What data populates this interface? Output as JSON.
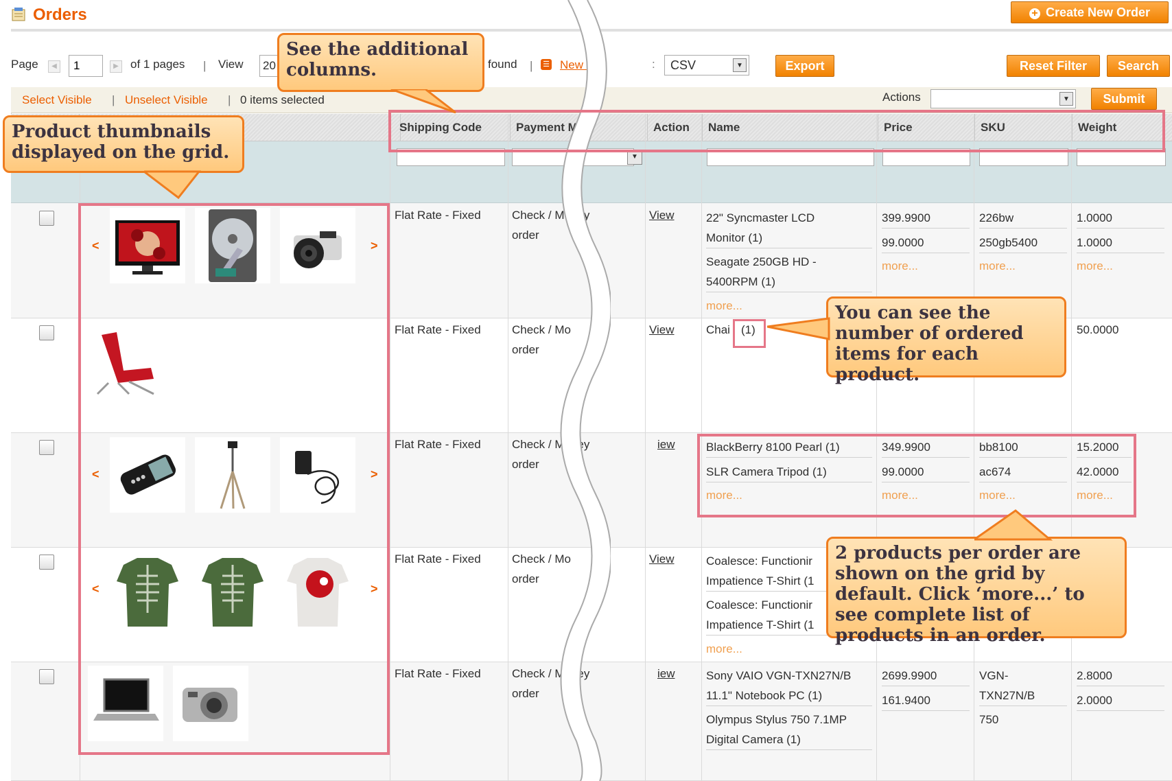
{
  "header": {
    "title": "Orders",
    "create_button": "Create New Order"
  },
  "pager": {
    "page_label": "Page",
    "page_value": "1",
    "of_pages": "of 1 pages",
    "view_label": "View",
    "view_value": "20",
    "found": "found",
    "rss_link": "New O",
    "export_value": "CSV",
    "export_button": "Export",
    "reset_button": "Reset Filter",
    "search_button": "Search"
  },
  "massaction": {
    "select_visible": "Select Visible",
    "unselect_visible": "Unselect Visible",
    "items_selected": "0 items selected",
    "actions_label": "Actions",
    "submit_button": "Submit"
  },
  "columns": {
    "shipping": "Shipping Code",
    "payment": "Payment M",
    "action": "Action",
    "name": "Name",
    "price": "Price",
    "sku": "SKU",
    "weight": "Weight"
  },
  "rows": [
    {
      "shipping": "Flat Rate - Fixed",
      "payment1": "Check / Money",
      "payment2": "order",
      "action": "View",
      "name1a": "22\" Syncmaster LCD",
      "name1b": "Monitor (1)",
      "name2a": "Seagate 250GB HD -",
      "name2b": "5400RPM (1)",
      "name_more": "more...",
      "price1": "399.9900",
      "price2": "99.0000",
      "price_more": "more...",
      "sku1": "226bw",
      "sku2": "250gb5400",
      "sku_more": "more...",
      "weight1": "1.0000",
      "weight2": "1.0000",
      "weight_more": "more..."
    },
    {
      "shipping": "Flat Rate - Fixed",
      "payment1": "Check / Mo",
      "payment2": "order",
      "action": "View",
      "name1a": "Chai",
      "name1b": "(1)",
      "weight1": "50.0000"
    },
    {
      "shipping": "Flat Rate - Fixed",
      "payment1": "Check / Money",
      "payment2": "order",
      "action": "iew",
      "name1": "BlackBerry 8100 Pearl (1)",
      "name2": "SLR Camera Tripod (1)",
      "name_more": "more...",
      "price1": "349.9900",
      "price2": "99.0000",
      "price_more": "more...",
      "sku1": "bb8100",
      "sku2": "ac674",
      "sku_more": "more...",
      "weight1": "15.2000",
      "weight2": "42.0000",
      "weight_more": "more..."
    },
    {
      "shipping": "Flat Rate - Fixed",
      "payment1": "Check / Mo",
      "payment2": "order",
      "action": "View",
      "name1a": "Coalesce: Functionir",
      "name1b": "Impatience T-Shirt (1",
      "name2a": "Coalesce: Functionir",
      "name2b": "Impatience T-Shirt (1",
      "name_more": "more..."
    },
    {
      "shipping": "Flat Rate - Fixed",
      "payment1": "Check / Money",
      "payment2": "order",
      "action": "iew",
      "name1a": "Sony VAIO VGN-TXN27N/B",
      "name1b": "11.1\" Notebook PC (1)",
      "name2a": "Olympus Stylus 750 7.1MP",
      "name2b": "Digital Camera (1)",
      "price1": "2699.9900",
      "price2": "161.9400",
      "sku1a": "VGN-",
      "sku1b": "TXN27N/B",
      "sku2": "750",
      "weight1": "2.8000",
      "weight2": "2.0000"
    }
  ],
  "callouts": {
    "columns": "See the  additional columns.",
    "thumbnails": "Product thumbnails displayed on the grid.",
    "qty": "You can see the number of ordered items for each product.",
    "more": "2 products per order are shown on the grid by default. Click ‘more...’ to see complete list of products in an order."
  },
  "colors": {
    "accent": "#eb5e00",
    "button": "#f18200",
    "highlight": "#e57688",
    "callout_fill": "#ffd699",
    "callout_border": "#ef7d1f"
  }
}
